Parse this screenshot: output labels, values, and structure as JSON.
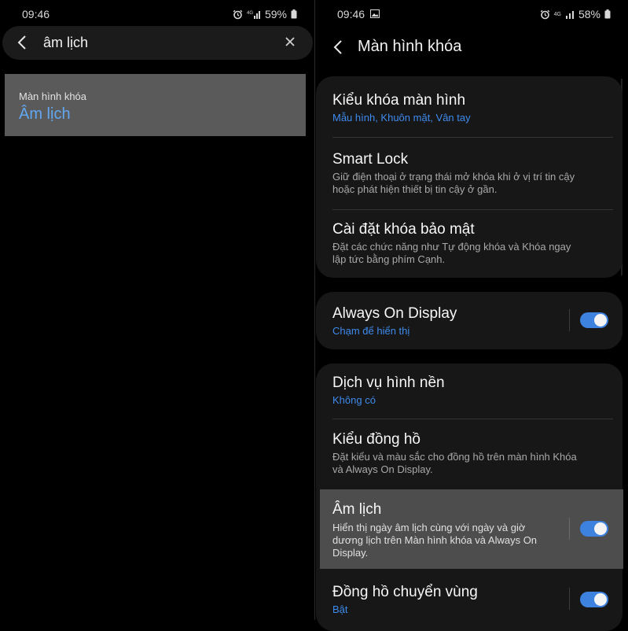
{
  "left_screen": {
    "status": {
      "time": "09:46",
      "battery": "59%"
    },
    "search": {
      "query": "âm lịch"
    },
    "result": {
      "path": "Màn hình khóa",
      "title": "Âm lịch"
    }
  },
  "right_screen": {
    "status": {
      "time": "09:46",
      "network": "4G",
      "battery": "58%"
    },
    "title": "Màn hình khóa",
    "groups": [
      {
        "items": [
          {
            "title": "Kiểu khóa màn hình",
            "subtitle": "Mẫu hình, Khuôn mặt, Vân tay"
          },
          {
            "title": "Smart Lock",
            "subtitle_lines": [
              "Giữ điện thoại ở trạng thái mở khóa khi ở vị trí tin cậy",
              "hoặc phát hiện thiết bị tin cậy ở gần."
            ]
          },
          {
            "title": "Cài đặt khóa bảo mật",
            "subtitle_lines": [
              "Đặt các chức năng như Tự động khóa và Khóa ngay",
              "lập tức bằng phím Cạnh."
            ]
          }
        ]
      },
      {
        "items": [
          {
            "title": "Always On Display",
            "subtitle": "Chạm để hiển thị",
            "toggle": true
          }
        ]
      },
      {
        "items": [
          {
            "title": "Dịch vụ hình nền",
            "subtitle": "Không có"
          },
          {
            "title": "Kiểu đồng hồ",
            "subtitle_lines": [
              "Đặt kiểu và màu sắc cho đồng hồ trên màn hình Khóa",
              "và Always On Display."
            ]
          },
          {
            "title": "Âm lịch",
            "subtitle_lines": [
              "Hiển thị ngày âm lịch cùng với ngày và giờ",
              "dương lịch trên Màn hình khóa và Always On",
              "Display."
            ],
            "toggle": true,
            "highlighted": true
          },
          {
            "title": "Đồng hồ chuyển vùng",
            "subtitle": "Bật",
            "toggle": true
          }
        ]
      }
    ]
  },
  "colors": {
    "accent": "#3e8bee",
    "highlight_bg": "#4d4d4d",
    "card_bg": "#171717",
    "toggle_on": "#3e82e0"
  },
  "icons": [
    "back-arrow-icon",
    "close-icon",
    "alarm-icon",
    "signal-icon",
    "battery-icon",
    "gallery-icon"
  ]
}
